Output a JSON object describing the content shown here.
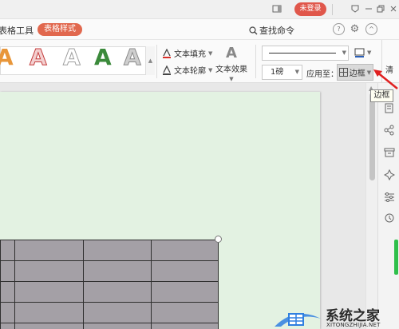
{
  "titlebar": {
    "login_label": "未登录",
    "icons": [
      "window-icon",
      "skin-icon",
      "minimize-icon",
      "restore-icon",
      "close-icon"
    ]
  },
  "tabbar": {
    "prev_tab_label": "表格工具",
    "active_tab_label": "表格样式",
    "search_label": "查找命令",
    "icons": [
      "help-icon",
      "settings-icon",
      "collapse-ribbon-icon"
    ]
  },
  "ribbon": {
    "art_letters": [
      {
        "letter": "A",
        "color": "#e8963a"
      },
      {
        "letter": "A",
        "color": "#c33a3a"
      },
      {
        "letter": "A",
        "color": "#9e9e9e"
      },
      {
        "letter": "A",
        "color": "#3b8a3b"
      },
      {
        "letter": "A",
        "color": "#a8a8a8"
      }
    ],
    "text_fill_label": "文本填充",
    "text_outline_label": "文本轮廓",
    "text_effect_label": "文本效果",
    "line_weight_value": "1磅",
    "apply_to_label": "应用至：",
    "border_button_label": "边框",
    "right_cut_label": "清"
  },
  "tooltip": {
    "text": "边框"
  },
  "watermark": {
    "name": "系统之家",
    "url": "XITONGZHIJIA.NET"
  },
  "colors": {
    "accent": "#e1684e",
    "page_bg": "#e3f2e2",
    "cell_fill": "#a4a0a6",
    "arrow": "#e02020"
  }
}
